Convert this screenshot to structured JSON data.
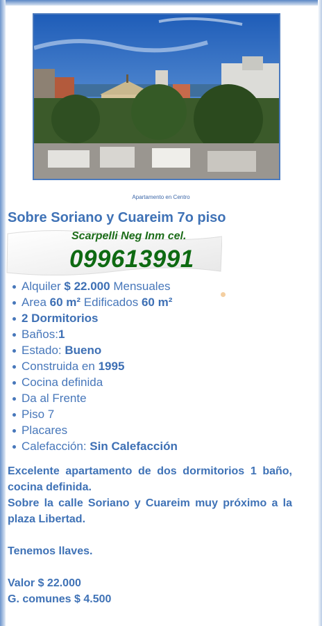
{
  "caption": "Apartamento en Centro",
  "title": "Sobre Soriano y Cuareim 7o piso",
  "agent": "Scarpelli Neg Inm cel.",
  "phone": "099613991",
  "features": [
    {
      "pre": "Alquiler ",
      "strong": "$ 22.000",
      "post": " Mensuales"
    },
    {
      "pre": "Area ",
      "strong": "60 m²",
      "post": " Edificados ",
      "strong2": "60 m²"
    },
    {
      "pre": "",
      "strong": "2 Dormitorios",
      "post": ""
    },
    {
      "pre": "Baños:",
      "strong": "1",
      "post": ""
    },
    {
      "pre": "Estado: ",
      "strong": "Bueno",
      "post": ""
    },
    {
      "pre": "Construida en ",
      "strong": "1995",
      "post": ""
    },
    {
      "pre": "Cocina definida",
      "strong": "",
      "post": ""
    },
    {
      "pre": "Da al Frente",
      "strong": "",
      "post": ""
    },
    {
      "pre": "Piso 7",
      "strong": "",
      "post": ""
    },
    {
      "pre": "Placares",
      "strong": "",
      "post": ""
    },
    {
      "pre": "Calefacción: ",
      "strong": "Sin Calefacción",
      "post": ""
    }
  ],
  "description": {
    "line1": "Excelente apartamento de dos dormitorios 1 baño, cocina definida.",
    "line2": "Sobre la calle Soriano y Cuareim muy próximo a la plaza Libertad.",
    "line3": "Tenemos llaves.",
    "price": "Valor $ 22.000",
    "fees": "G. comunes $ 4.500"
  },
  "colors": {
    "accent": "#3f72b6",
    "phone_green": "#0e6a12"
  }
}
